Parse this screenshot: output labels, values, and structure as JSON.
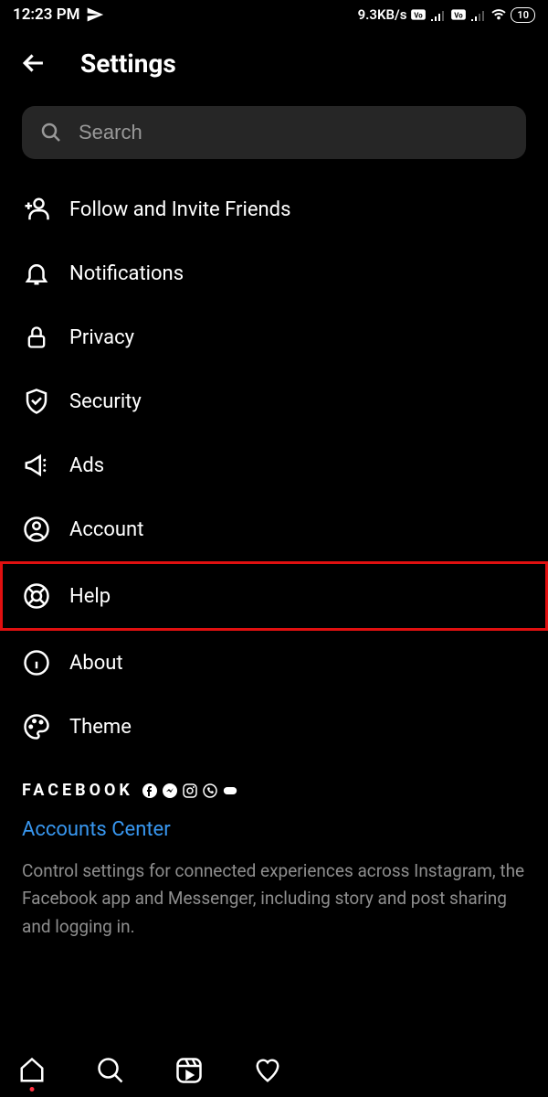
{
  "status": {
    "time": "12:23 PM",
    "network_speed": "9.3KB/s",
    "battery": "10"
  },
  "header": {
    "title": "Settings"
  },
  "search": {
    "placeholder": "Search"
  },
  "menu": {
    "follow": "Follow and Invite Friends",
    "notifications": "Notifications",
    "privacy": "Privacy",
    "security": "Security",
    "ads": "Ads",
    "account": "Account",
    "help": "Help",
    "about": "About",
    "theme": "Theme"
  },
  "facebook": {
    "label": "FACEBOOK",
    "accounts_center": "Accounts Center",
    "description": "Control settings for connected experiences across Instagram, the Facebook app and Messenger, including story and post sharing and logging in."
  }
}
